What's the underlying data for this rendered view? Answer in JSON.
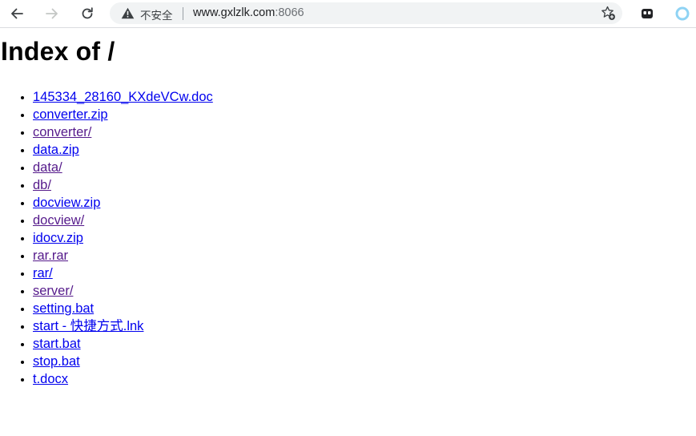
{
  "browser": {
    "security_label": "不安全",
    "url_host": "www.gxlzlk.com",
    "url_port": ":8066",
    "icons": [
      "back-arrow-icon",
      "forward-arrow-icon",
      "reload-icon",
      "warning-icon",
      "add-favorite-icon",
      "extension-icon",
      "profile-icon"
    ]
  },
  "page": {
    "heading": "Index of /",
    "entries": [
      {
        "name": "145334_28160_KXdeVCw.doc",
        "visited": false
      },
      {
        "name": "converter.zip",
        "visited": false
      },
      {
        "name": "converter/",
        "visited": true
      },
      {
        "name": "data.zip",
        "visited": false
      },
      {
        "name": "data/",
        "visited": true
      },
      {
        "name": "db/",
        "visited": true
      },
      {
        "name": "docview.zip",
        "visited": false
      },
      {
        "name": "docview/",
        "visited": true
      },
      {
        "name": "idocv.zip",
        "visited": false
      },
      {
        "name": "rar.rar",
        "visited": true
      },
      {
        "name": "rar/",
        "visited": false
      },
      {
        "name": "server/",
        "visited": true
      },
      {
        "name": "setting.bat",
        "visited": false
      },
      {
        "name": "start - 快捷方式.lnk",
        "visited": false
      },
      {
        "name": "start.bat",
        "visited": false
      },
      {
        "name": "stop.bat",
        "visited": false
      },
      {
        "name": "t.docx",
        "visited": false
      }
    ]
  },
  "colors": {
    "link": "#0000ee",
    "visited_link": "#551a8b",
    "profile_accent": "#8fd3f4"
  }
}
